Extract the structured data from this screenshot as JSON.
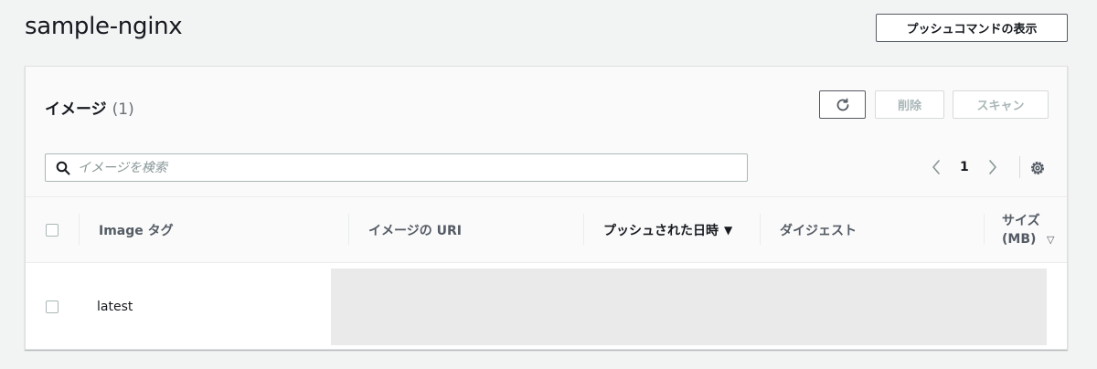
{
  "page": {
    "title": "sample-nginx",
    "push_commands_label": "プッシュコマンドの表示"
  },
  "images_panel": {
    "title": "イメージ",
    "count": "(1)",
    "delete_label": "削除",
    "scan_label": "スキャン",
    "search_placeholder": "イメージを検索",
    "current_page": "1"
  },
  "table": {
    "columns": {
      "tag": "Image タグ",
      "uri": "イメージの URI",
      "pushed_at": "プッシュされた日時",
      "pushed_at_sort": "▼",
      "digest": "ダイジェスト",
      "size_line1": "サイズ",
      "size_line2": "(MB)",
      "size_sort": "▽"
    },
    "rows": [
      {
        "tag": "latest"
      }
    ]
  },
  "icons": {
    "refresh": "refresh-icon",
    "search": "search-icon",
    "prev": "chevron-left-icon",
    "next": "chevron-right-icon",
    "settings": "gear-icon"
  }
}
